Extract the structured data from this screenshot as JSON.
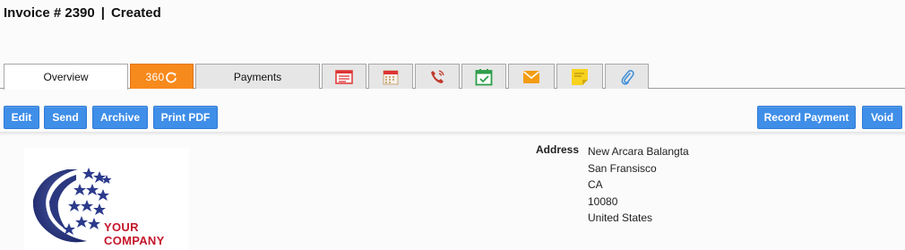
{
  "header": {
    "invoice_label": "Invoice # 2390",
    "separator": "|",
    "status": "Created"
  },
  "tabs": [
    {
      "label": "Overview",
      "active": true
    },
    {
      "label": "360",
      "icon": "refresh-icon",
      "accent": "#f78a1c"
    },
    {
      "label": "Payments"
    },
    {
      "icon": "document-list-icon"
    },
    {
      "icon": "calendar-icon"
    },
    {
      "icon": "phone-icon"
    },
    {
      "icon": "calendar-check-icon"
    },
    {
      "icon": "envelope-icon"
    },
    {
      "icon": "sticky-note-icon"
    },
    {
      "icon": "paperclip-icon"
    }
  ],
  "toolbar": {
    "edit": "Edit",
    "send": "Send",
    "archive": "Archive",
    "print_pdf": "Print PDF",
    "record_payment": "Record Payment",
    "void": "Void",
    "button_color": "#3f8ee8"
  },
  "logo": {
    "line1": "YOUR",
    "line2": "COMPANY"
  },
  "address": {
    "label": "Address",
    "line1": "New Arcara Balangta",
    "line2": "San Fransisco",
    "line3": "CA",
    "line4": "10080",
    "line5": "United States"
  }
}
